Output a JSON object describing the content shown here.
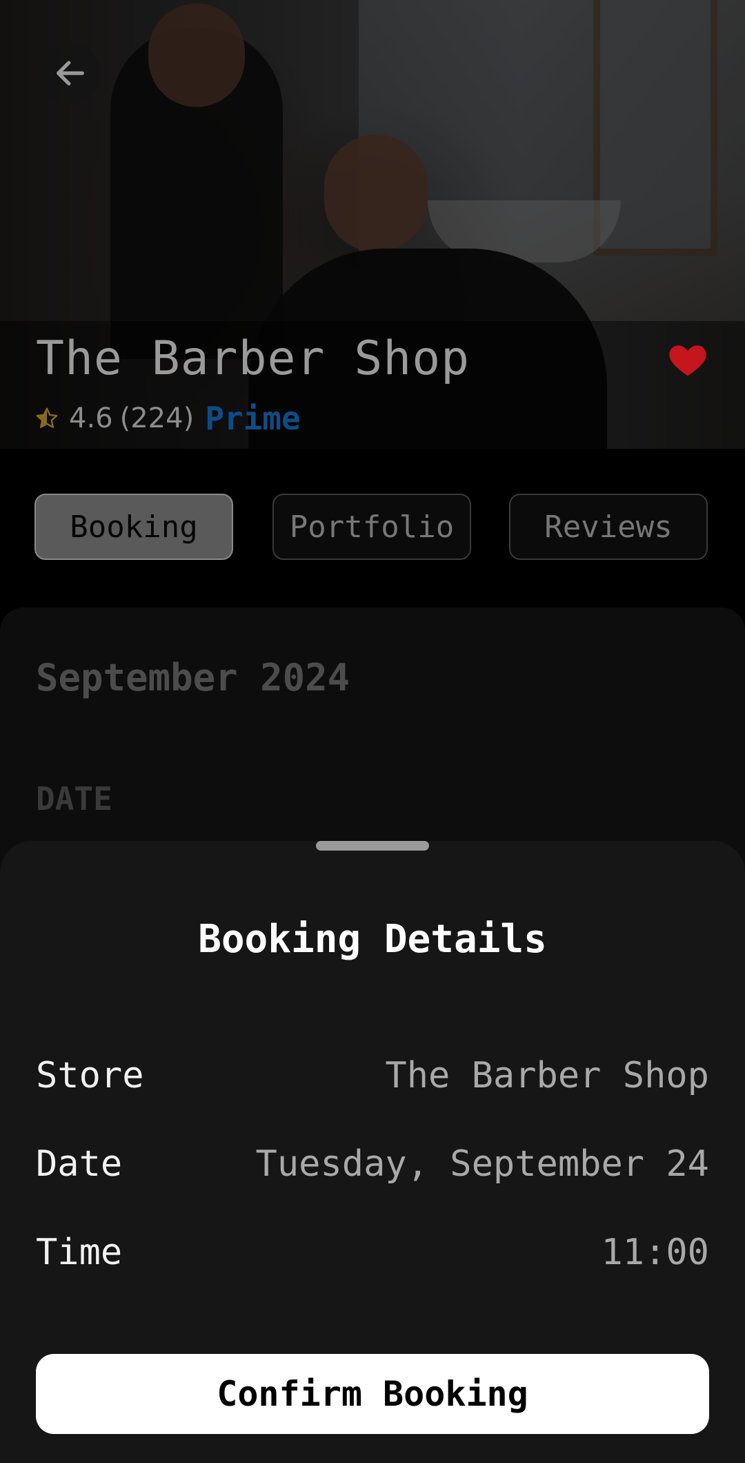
{
  "header": {
    "back_icon": "arrow-left-icon",
    "shop_name": "The Barber Shop",
    "favorite_icon": "heart-icon",
    "favorite_color": "#c4161c",
    "rating": {
      "star_icon": "half-star-icon",
      "score": "4.6",
      "count": "(224)",
      "badge": "Prime",
      "badge_color": "#0f4c87"
    }
  },
  "tabs": [
    {
      "label": "Booking",
      "active": true
    },
    {
      "label": "Portfolio",
      "active": false
    },
    {
      "label": "Reviews",
      "active": false
    }
  ],
  "calendar": {
    "month": "September 2024",
    "date_label": "DATE"
  },
  "booking_sheet": {
    "title": "Booking Details",
    "rows": [
      {
        "label": "Store",
        "value": "The Barber Shop"
      },
      {
        "label": "Date",
        "value": "Tuesday, September 24"
      },
      {
        "label": "Time",
        "value": "11:00"
      }
    ],
    "confirm_label": "Confirm Booking"
  }
}
